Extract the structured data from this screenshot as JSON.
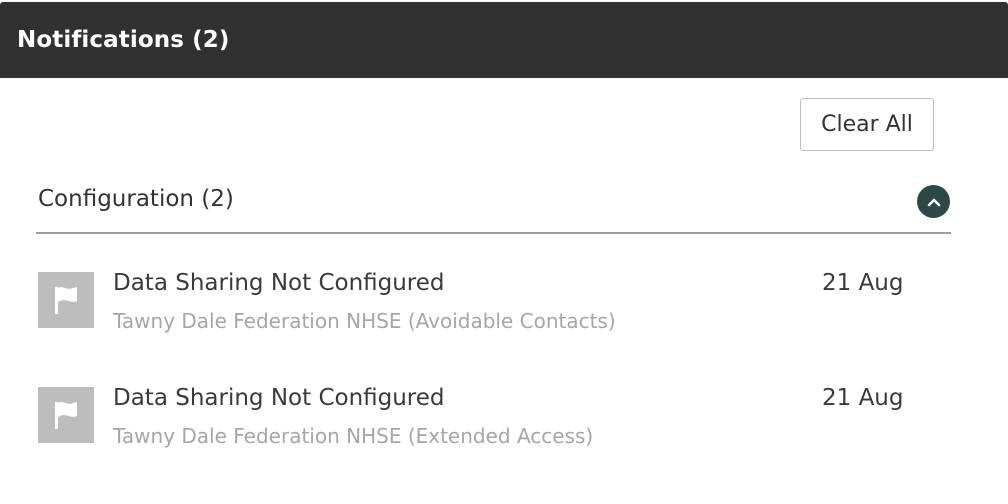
{
  "header": {
    "title": "Notifications  (2)"
  },
  "actions": {
    "clear_all_label": "Clear All"
  },
  "group": {
    "title": "Configuration (2)",
    "toggle_icon": "chevron-up-icon",
    "toggle_color": "#2e4848"
  },
  "notifications": [
    {
      "icon": "flag-icon",
      "title": "Data Sharing Not Configured",
      "subtitle": "Tawny Dale Federation NHSE (Avoidable Contacts)",
      "date": "21 Aug"
    },
    {
      "icon": "flag-icon",
      "title": "Data Sharing Not Configured",
      "subtitle": "Tawny Dale Federation NHSE (Extended Access)",
      "date": "21 Aug"
    }
  ],
  "colors": {
    "header_bg": "#313131",
    "icon_bg": "#bdbdbd",
    "subtitle_text": "#a6a6a6"
  }
}
